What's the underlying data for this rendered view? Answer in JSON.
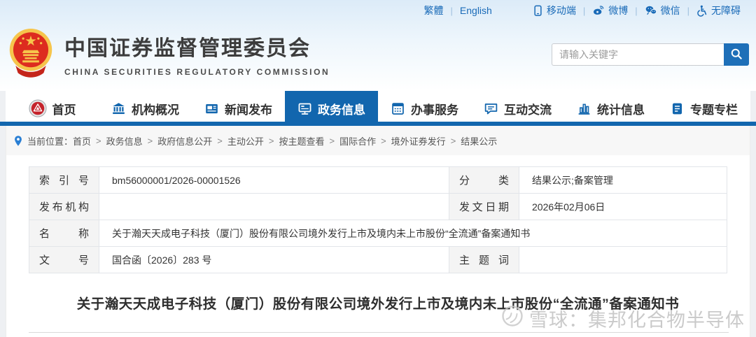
{
  "topbar": {
    "traditional": "繁體",
    "english": "English",
    "mobile": "移动端",
    "weibo": "微博",
    "wechat": "微信",
    "accessibility": "无障碍",
    "divider": "|"
  },
  "header": {
    "title_cn": "中国证券监督管理委员会",
    "title_en": "CHINA SECURITIES REGULATORY COMMISSION",
    "search_placeholder": "请输入关键字"
  },
  "nav": {
    "items": [
      {
        "label": "首页",
        "icon": "csrc-logo",
        "active": false
      },
      {
        "label": "机构概况",
        "icon": "bank",
        "active": false
      },
      {
        "label": "新闻发布",
        "icon": "news",
        "active": false
      },
      {
        "label": "政务信息",
        "icon": "monitor",
        "active": true
      },
      {
        "label": "办事服务",
        "icon": "service-doc",
        "active": false
      },
      {
        "label": "互动交流",
        "icon": "chat-bubble",
        "active": false
      },
      {
        "label": "统计信息",
        "icon": "bar-chart",
        "active": false
      },
      {
        "label": "专题专栏",
        "icon": "topic-doc",
        "active": false
      }
    ]
  },
  "breadcrumb": {
    "prefix": "当前位置：",
    "separator": ">",
    "items": [
      "首页",
      "政务信息",
      "政府信息公开",
      "主动公开",
      "按主题查看",
      "国际合作",
      "境外证券发行",
      "结果公示"
    ]
  },
  "info_table": {
    "index_label": "索 引 号",
    "index_value": "bm56000001/2026-00001526",
    "category_label": "分 类",
    "category_value": "结果公示;备案管理",
    "publisher_label": "发布机构",
    "publisher_value": "",
    "date_label": "发文日期",
    "date_value": "2026年02月06日",
    "name_label": "名 称",
    "name_value": "关于瀚天天成电子科技（厦门）股份有限公司境外发行上市及境内未上市股份“全流通”备案通知书",
    "doc_no_label": "文 号",
    "doc_no_value": "国合函〔2026〕283 号",
    "subject_label": "主 题 词",
    "subject_value": ""
  },
  "article": {
    "title": "关于瀚天天成电子科技（厦门）股份有限公司境外发行上市及境内未上市股份“全流通”备案通知书"
  },
  "watermark": {
    "text": "雪球：集邦化合物半导体"
  },
  "colors": {
    "accent_blue": "#1266ae",
    "link_blue": "#1a6bb8",
    "search_button_blue": "#1e6fb8",
    "emblem_red": "#dd2c1f",
    "emblem_gold": "#f6c54c"
  }
}
